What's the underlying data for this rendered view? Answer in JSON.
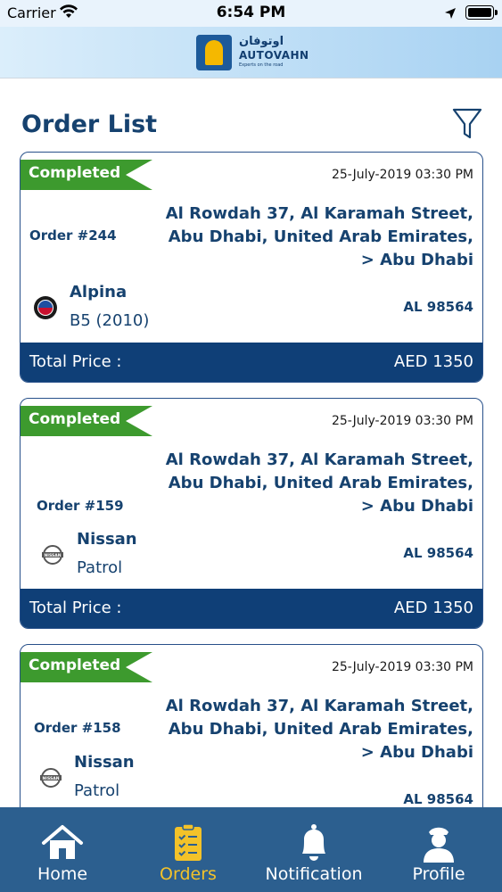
{
  "status_bar": {
    "carrier": "Carrier",
    "time": "6:54 PM"
  },
  "header": {
    "brand_arabic": "اوتوفان",
    "brand_name": "AUTOVAHN",
    "tagline": "Experts on the road"
  },
  "page": {
    "title": "Order List"
  },
  "orders": [
    {
      "status": "Completed",
      "date": "25-July-2019 03:30 PM",
      "order_number": "Order #244",
      "address_lines": [
        "Al Rowdah 37, Al Karamah Street,",
        "Abu Dhabi, United Arab Emirates,",
        "> Abu Dhabi"
      ],
      "car_make": "Alpina",
      "car_model": "B5 (2010)",
      "plate": "AL 98564",
      "total_label": "Total Price :",
      "total_value": "AED 1350",
      "brand_icon": "alpina-logo-icon"
    },
    {
      "status": "Completed",
      "date": "25-July-2019 03:30 PM",
      "order_number": "Order #159",
      "address_lines": [
        "Al Rowdah 37, Al Karamah Street,",
        "Abu Dhabi, United Arab Emirates,",
        "> Abu Dhabi"
      ],
      "car_make": "Nissan",
      "car_model": "Patrol",
      "plate": "AL 98564",
      "total_label": "Total Price :",
      "total_value": "AED 1350",
      "brand_icon": "nissan-logo-icon"
    },
    {
      "status": "Completed",
      "date": "25-July-2019 03:30 PM",
      "order_number": "Order #158",
      "address_lines": [
        "Al Rowdah 37, Al Karamah Street,",
        "Abu Dhabi, United Arab Emirates,",
        "> Abu Dhabi"
      ],
      "car_make": "Nissan",
      "car_model": "Patrol",
      "plate": "AL 98564",
      "brand_icon": "nissan-logo-icon"
    }
  ],
  "tab_bar": {
    "items": [
      {
        "label": "Home",
        "icon": "home-icon",
        "active": false
      },
      {
        "label": "Orders",
        "icon": "orders-icon",
        "active": true
      },
      {
        "label": "Notification",
        "icon": "bell-icon",
        "active": false
      },
      {
        "label": "Profile",
        "icon": "profile-icon",
        "active": false
      }
    ]
  },
  "colors": {
    "primary": "#0f3f77",
    "status_completed": "#3d9a2e",
    "active_tab": "#f3c229",
    "tab_bar": "#2c5f8f"
  }
}
